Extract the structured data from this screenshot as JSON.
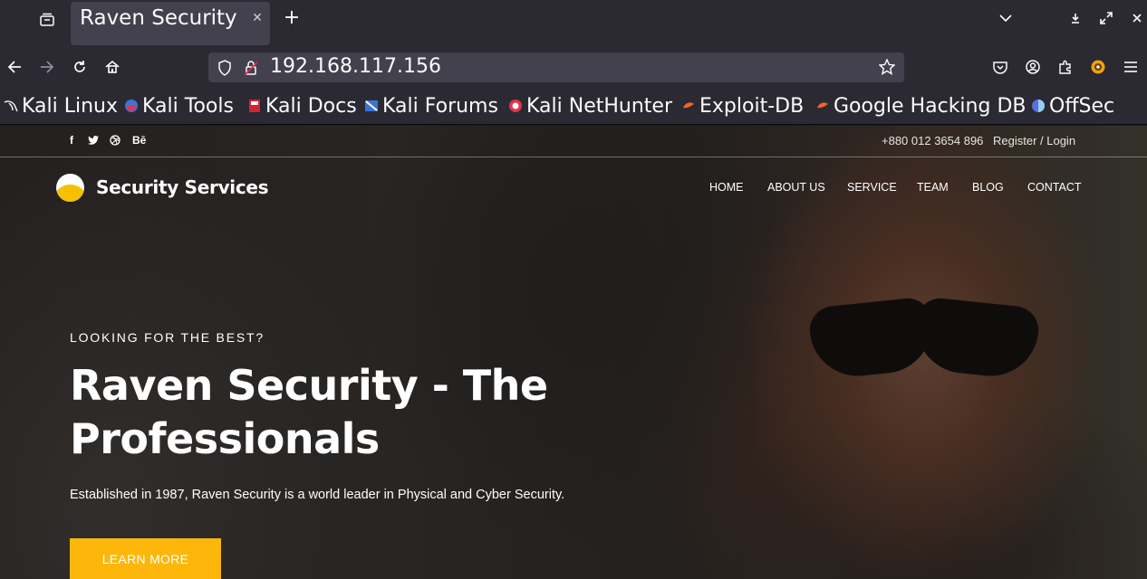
{
  "browser": {
    "tab": {
      "title": "Raven Security"
    },
    "url": "192.168.117.156",
    "bookmarks": [
      {
        "label": "Kali Linux",
        "icon": "kali-dragon-icon"
      },
      {
        "label": "Kali Tools",
        "icon": "kali-tools-icon"
      },
      {
        "label": "Kali Docs",
        "icon": "kali-docs-icon"
      },
      {
        "label": "Kali Forums",
        "icon": "kali-forums-icon"
      },
      {
        "label": "Kali NetHunter",
        "icon": "nethunter-icon"
      },
      {
        "label": "Exploit-DB",
        "icon": "exploit-db-icon"
      },
      {
        "label": "Google Hacking DB",
        "icon": "ghdb-icon"
      },
      {
        "label": "OffSec",
        "icon": "offsec-icon"
      }
    ]
  },
  "site": {
    "social": [
      "f",
      "Bē"
    ],
    "phone": "+880 012 3654 896",
    "login": "Register / Login",
    "logo_text": "Security Services",
    "menu": [
      "HOME",
      "ABOUT US",
      "SERVICE",
      "TEAM",
      "BLOG",
      "CONTACT"
    ],
    "hero": {
      "eyebrow": "LOOKING FOR THE BEST?",
      "title": "Raven Security - The Professionals",
      "subtitle": "Established in 1987, Raven Security is a world leader in Physical and Cyber Security.",
      "cta": "LEARN MORE"
    },
    "colors": {
      "accent": "#fcb70a",
      "text": "#ffffff"
    }
  }
}
